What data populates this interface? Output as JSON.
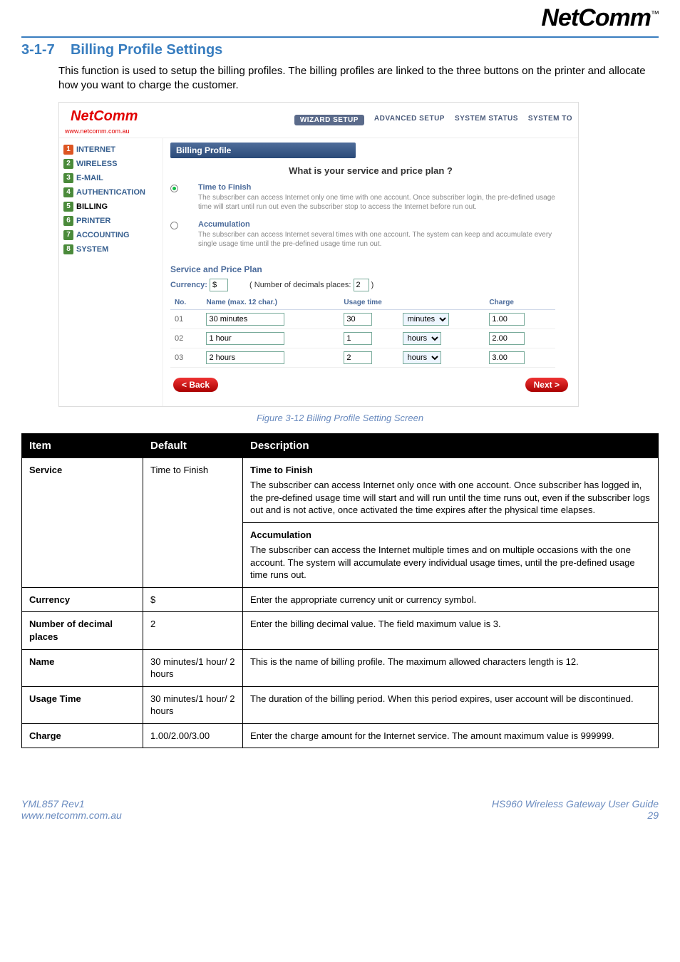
{
  "logo_text": "NetComm",
  "logo_tm": "™",
  "section_number": "3-1-7",
  "section_title": "Billing Profile Settings",
  "intro": "This function is used to setup the billing profiles. The billing profiles are linked to the three buttons on the printer and allocate how you want to charge the customer.",
  "figure_caption": "Figure 3-12 Billing Profile Setting Screen",
  "screenshot": {
    "logo": "NetComm",
    "url": "www.netcomm.com.au",
    "tabs": [
      "WIZARD SETUP",
      "ADVANCED SETUP",
      "SYSTEM STATUS",
      "SYSTEM TO"
    ],
    "active_tab_index": 0,
    "sidebar": [
      {
        "n": "1",
        "label": "INTERNET",
        "g": false
      },
      {
        "n": "2",
        "label": "WIRELESS",
        "g": true
      },
      {
        "n": "3",
        "label": "E-MAIL",
        "g": true
      },
      {
        "n": "4",
        "label": "AUTHENTICATION",
        "g": true
      },
      {
        "n": "5",
        "label": "BILLING",
        "g": true
      },
      {
        "n": "6",
        "label": "PRINTER",
        "g": true
      },
      {
        "n": "7",
        "label": "ACCOUNTING",
        "g": true
      },
      {
        "n": "8",
        "label": "SYSTEM",
        "g": true
      }
    ],
    "panel_title": "Billing Profile",
    "question": "What is your service and price plan ?",
    "opt1_title": "Time to Finish",
    "opt1_desc": "The subscriber can access Internet only one time with one account. Once subscriber login, the pre-defined usage time will start until run out even the subscriber stop to access the Internet before run out.",
    "opt2_title": "Accumulation",
    "opt2_desc": "The subscriber can access Internet several times with one account. The system can keep and accumulate every single usage time until the pre-defined usage time run out.",
    "service_plan_heading": "Service and Price Plan",
    "currency_label": "Currency:",
    "currency_value": "$",
    "decimals_label": "( Number of decimals places:",
    "decimals_value": "2",
    "decimals_close": ")",
    "plan_headers": [
      "No.",
      "Name (max. 12 char.)",
      "Usage time",
      "Charge"
    ],
    "plan_rows": [
      {
        "no": "01",
        "name": "30 minutes",
        "qty": "30",
        "unit": "minutes",
        "charge": "1.00"
      },
      {
        "no": "02",
        "name": "1 hour",
        "qty": "1",
        "unit": "hours",
        "charge": "2.00"
      },
      {
        "no": "03",
        "name": "2 hours",
        "qty": "2",
        "unit": "hours",
        "charge": "3.00"
      }
    ],
    "back_btn": "< Back",
    "next_btn": "Next >"
  },
  "doc_table": {
    "headers": [
      "Item",
      "Default",
      "Description"
    ],
    "rows": [
      {
        "item": "Service",
        "default": "Time to Finish",
        "desc": [
          {
            "head": "Time to Finish",
            "body": "The subscriber can access Internet only once with one account. Once subscriber has logged in, the pre-defined usage time will start and will run until the time runs out, even if the subscriber logs out and is not active, once activated the time expires after the physical time elapses."
          },
          {
            "head": "Accumulation",
            "body": "The subscriber can access the Internet multiple times and on multiple occasions with the one account. The system will accumulate every individual usage times, until the pre-defined usage time runs out."
          }
        ]
      },
      {
        "item": "Currency",
        "default": "$",
        "desc_plain": "Enter the appropriate currency unit or currency symbol."
      },
      {
        "item": "Number of decimal places",
        "default": "2",
        "desc_plain": "Enter the billing decimal value. The field maximum value is 3."
      },
      {
        "item": "Name",
        "default": "30 minutes/1 hour/ 2 hours",
        "desc_plain": "This is the name of billing profile. The maximum allowed characters length is 12."
      },
      {
        "item": "Usage Time",
        "default": "30 minutes/1 hour/ 2 hours",
        "desc_plain": "The duration of the billing period. When this period expires, user account will be discontinued."
      },
      {
        "item": "Charge",
        "default": "1.00/2.00/3.00",
        "desc_plain": "Enter the charge amount for the Internet service. The amount maximum value is 999999."
      }
    ]
  },
  "footer": {
    "left1": "YML857 Rev1",
    "left2": "www.netcomm.com.au",
    "right1": "HS960 Wireless Gateway User Guide",
    "right2": "29"
  }
}
